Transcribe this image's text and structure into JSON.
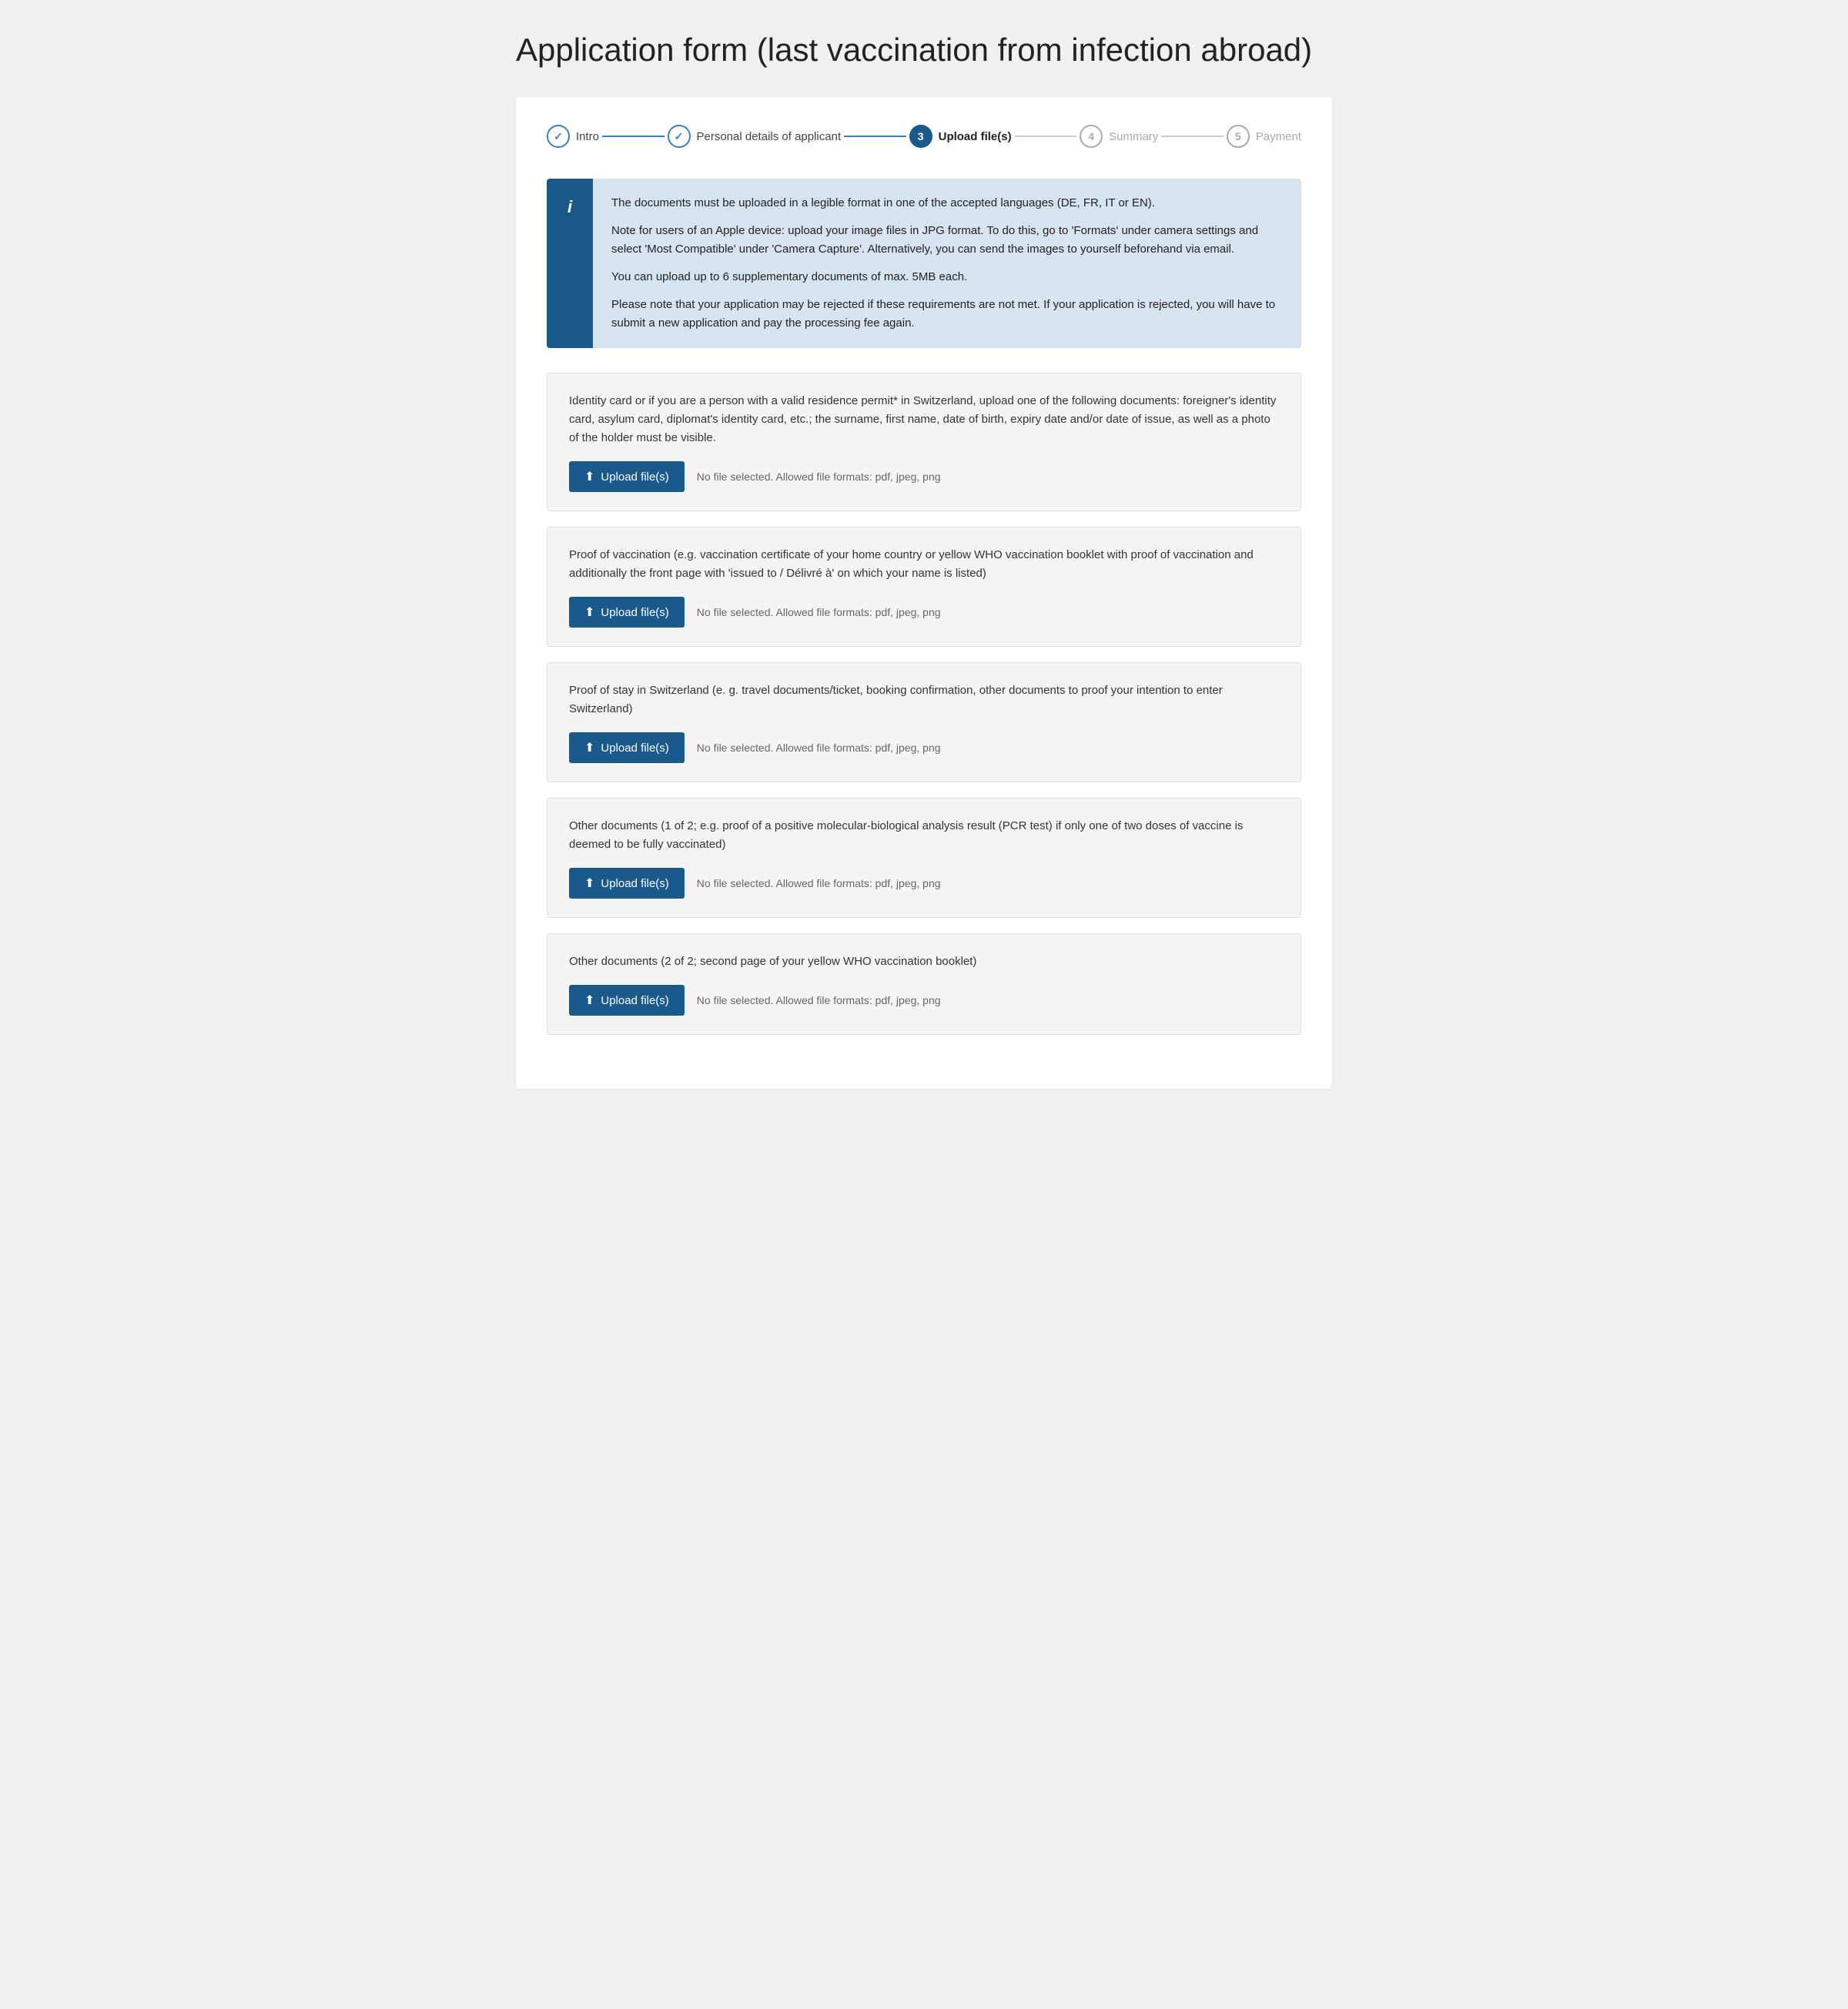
{
  "page": {
    "title": "Application form (last vaccination from infection abroad)"
  },
  "stepper": {
    "steps": [
      {
        "id": "intro",
        "label": "Intro",
        "state": "done",
        "number": "✓"
      },
      {
        "id": "personal",
        "label": "Personal details of applicant",
        "state": "done",
        "number": "✓"
      },
      {
        "id": "upload",
        "label": "Upload file(s)",
        "state": "active",
        "number": "3"
      },
      {
        "id": "summary",
        "label": "Summary",
        "state": "inactive",
        "number": "4"
      },
      {
        "id": "payment",
        "label": "Payment",
        "state": "inactive",
        "number": "5"
      }
    ]
  },
  "infoBox": {
    "icon": "i",
    "paragraphs": [
      "The documents must be uploaded in a legible format in one of the accepted languages (DE, FR, IT or EN).",
      "Note for users of an Apple device: upload your image files in JPG format. To do this, go to 'Formats' under camera settings and select 'Most Compatible' under 'Camera Capture'. Alternatively, you can send the images to yourself beforehand via email.",
      "You can upload up to 6 supplementary documents of max. 5MB each.",
      "Please note that your application may be rejected if these requirements are not met. If your application is rejected, you will have to submit a new application and pay the processing fee again."
    ]
  },
  "uploadSections": [
    {
      "id": "identity",
      "description": "Identity card or if you are a person with a valid residence permit* in Switzerland, upload one of the following documents: foreigner's identity card, asylum card, diplomat's identity card, etc.; the surname, first name, date of birth, expiry date and/or date of issue, as well as a photo of the holder must be visible.",
      "buttonLabel": "Upload file(s)",
      "statusText": "No file selected.  Allowed file formats: pdf, jpeg, png"
    },
    {
      "id": "vaccination-proof",
      "description": "Proof of vaccination (e.g. vaccination certificate of your home country or yellow WHO vaccination booklet with proof of vaccination and additionally the front page with 'issued to / Délivré à' on which your name is listed)",
      "buttonLabel": "Upload file(s)",
      "statusText": "No file selected.  Allowed file formats: pdf, jpeg, png"
    },
    {
      "id": "stay-proof",
      "description": "Proof of stay in Switzerland (e. g. travel documents/ticket, booking confirmation, other documents to proof your intention to enter Switzerland)",
      "buttonLabel": "Upload file(s)",
      "statusText": "No file selected.  Allowed file formats: pdf, jpeg, png"
    },
    {
      "id": "other-1",
      "description": "Other documents (1 of 2; e.g. proof of a positive molecular-biological analysis result (PCR test) if only one of two doses of vaccine is deemed to be fully vaccinated)",
      "buttonLabel": "Upload file(s)",
      "statusText": "No file selected.  Allowed file formats: pdf, jpeg, png"
    },
    {
      "id": "other-2",
      "description": "Other documents (2 of 2; second page of your yellow WHO vaccination booklet)",
      "buttonLabel": "Upload file(s)",
      "statusText": "No file selected.  Allowed file formats: pdf, jpeg, png"
    }
  ],
  "colors": {
    "primary": "#1a5a8a",
    "stepDone": "#3a7fc1",
    "infoBg": "#d6e4f0",
    "sectionBg": "#f5f5f5"
  }
}
